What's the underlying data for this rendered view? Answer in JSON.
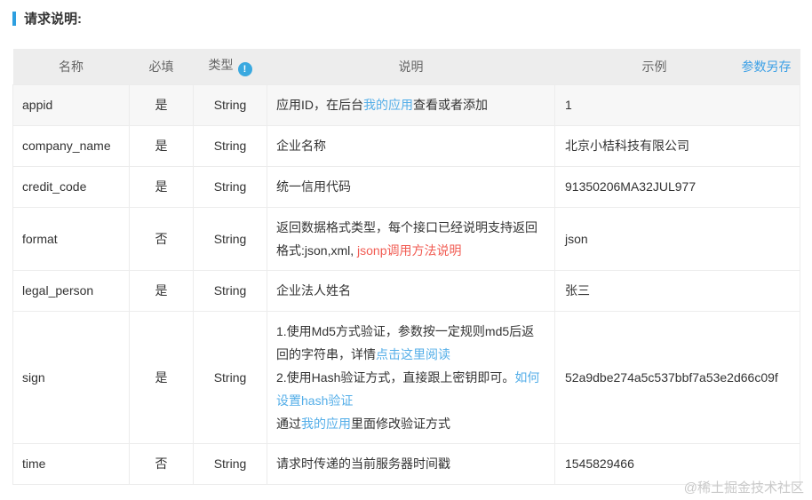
{
  "title": {
    "text": "请求说明:"
  },
  "watermark": {
    "text": "@稀土掘金技术社区"
  },
  "colors": {
    "accent_blue": "#2d9fe0",
    "link_blue": "#54aee8",
    "link_red": "#f15b52",
    "required_red": "#f15b52",
    "header_bg": "#ededed",
    "first_row_bg": "#f7f7f7",
    "border": "#ececec",
    "watermark_gray": "#c9c9c9"
  },
  "table": {
    "headers": {
      "name": "名称",
      "required": "必填",
      "type": "类型",
      "type_info": "!",
      "description": "说明",
      "example": "示例",
      "save_link": "参数另存"
    },
    "rows": [
      {
        "name": "appid",
        "required": "是",
        "type": "String",
        "example": "1",
        "desc": [
          [
            {
              "t": "应用ID，在后台"
            },
            {
              "t": "我的应用"
            },
            {
              "t": "查看或者添加"
            }
          ]
        ]
      },
      {
        "name": "company_name",
        "required": "是",
        "type": "String",
        "example": "北京小桔科技有限公司",
        "desc": [
          [
            {
              "t": "企业名称"
            }
          ]
        ]
      },
      {
        "name": "credit_code",
        "required": "是",
        "type": "String",
        "example": "91350206MA32JUL977",
        "desc": [
          [
            {
              "t": "统一信用代码"
            }
          ]
        ]
      },
      {
        "name": "format",
        "required": "否",
        "type": "String",
        "example": "json",
        "desc": [
          [
            {
              "t": "返回数据格式类型，每个接口已经说明支持返回格式:json,xml, "
            },
            {
              "t": "jsonp调用方法说明"
            }
          ]
        ]
      },
      {
        "name": "legal_person",
        "required": "是",
        "type": "String",
        "example": "张三",
        "desc": [
          [
            {
              "t": "企业法人姓名"
            }
          ]
        ]
      },
      {
        "name": "sign",
        "required": "是",
        "type": "String",
        "example": "52a9dbe274a5c537bbf7a53e2d66c09f",
        "desc": [
          [
            {
              "t": "1.使用Md5方式验证，参数按一定规则md5后返回的字符串，详情"
            },
            {
              "t": "点击这里阅读"
            }
          ],
          [
            {
              "t": "2.使用Hash验证方式，直接跟上密钥即可。"
            },
            {
              "t": "如何设置hash验证"
            }
          ],
          [
            {
              "t": "通过"
            },
            {
              "t": "我的应用"
            },
            {
              "t": "里面修改验证方式"
            }
          ]
        ]
      },
      {
        "name": "time",
        "required": "否",
        "type": "String",
        "example": "1545829466",
        "desc": [
          [
            {
              "t": "请求时传递的当前服务器时间戳"
            }
          ]
        ]
      }
    ]
  }
}
